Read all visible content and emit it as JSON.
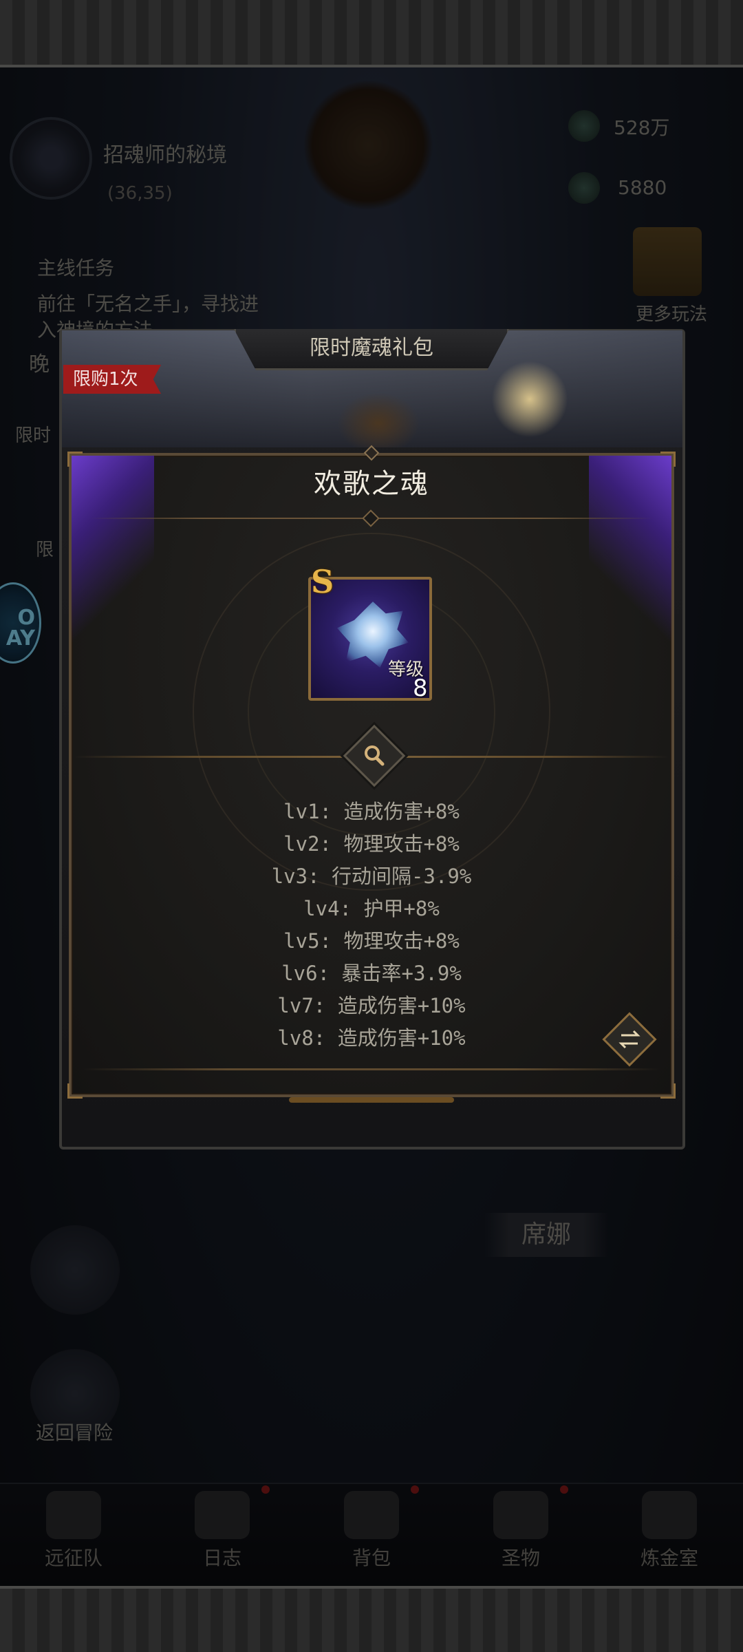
{
  "hud": {
    "location_name": "招魂师的秘境",
    "coords": "(36,35)",
    "gold": "528万",
    "gems": "5880",
    "more_play": "更多玩法",
    "quest_header": "主线任务",
    "quest_line1": "前往「无名之手」，寻找进",
    "quest_line2": "入神境的方法",
    "night_label": "晚",
    "side_label_1": "限时",
    "side_label_2": "限",
    "return_adventure": "返回冒险",
    "npc_name": "席娜",
    "badge_text": "O\nAY"
  },
  "tabs": [
    {
      "label": "远征队",
      "icon": "horned-helmet-icon",
      "alert": false
    },
    {
      "label": "日志",
      "icon": "scroll-icon",
      "alert": true
    },
    {
      "label": "背包",
      "icon": "backpack-icon",
      "alert": true
    },
    {
      "label": "圣物",
      "icon": "relic-icon",
      "alert": true
    },
    {
      "label": "炼金室",
      "icon": "alchemy-icon",
      "alert": false
    }
  ],
  "pack": {
    "title": "限时魔魂礼包",
    "limit_tag": "限购1次"
  },
  "soul": {
    "name": "欢歌之魂",
    "rank": "S",
    "level_label": "等级",
    "level": "8",
    "effects": [
      "lv1: 造成伤害+8%",
      "lv2: 物理攻击+8%",
      "lv3: 行动间隔-3.9%",
      "lv4: 护甲+8%",
      "lv5: 物理攻击+8%",
      "lv6: 暴击率+3.9%",
      "lv7: 造成伤害+10%",
      "lv8: 造成伤害+10%"
    ]
  },
  "colors": {
    "accent_gold": "#8c6c3c",
    "rank_gold": "#e7b54a",
    "limit_red": "#9e1b1b",
    "soul_purple": "#6a3cc9"
  }
}
